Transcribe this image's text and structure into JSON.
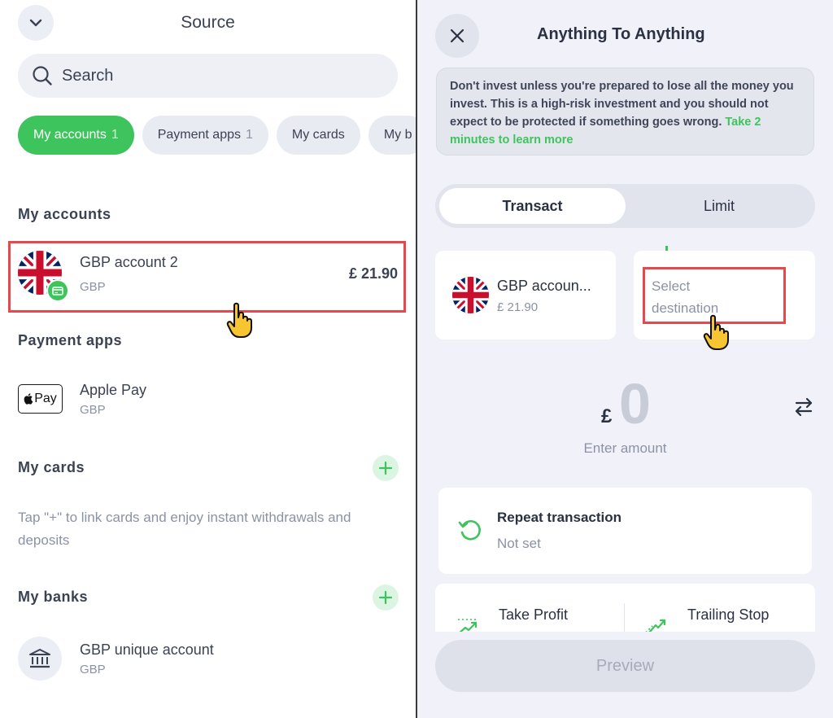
{
  "left": {
    "title": "Source",
    "search": {
      "placeholder": "Search"
    },
    "chips": [
      {
        "label": "My accounts",
        "count": "1"
      },
      {
        "label": "Payment apps",
        "count": "1"
      },
      {
        "label": "My cards"
      },
      {
        "label": "My b"
      }
    ],
    "accounts": {
      "title": "My accounts",
      "items": [
        {
          "name": "GBP account 2",
          "currency": "GBP",
          "balance": "£ 21.90"
        }
      ]
    },
    "payment_apps": {
      "title": "Payment apps",
      "items": [
        {
          "name": "Apple Pay",
          "currency": "GBP",
          "logo_text": "Pay"
        }
      ]
    },
    "cards": {
      "title": "My cards",
      "hint": "Tap \"+\" to link cards and enjoy instant withdrawals and deposits"
    },
    "banks": {
      "title": "My banks",
      "items": [
        {
          "name": "GBP unique account",
          "currency": "GBP"
        }
      ]
    }
  },
  "right": {
    "title": "Anything To Anything",
    "warning": {
      "text": "Don't invest unless you're prepared to lose all the money you invest. This is a high-risk investment and you should not expect to be protected if something goes wrong.",
      "link": "Take 2 minutes to learn more"
    },
    "tabs": [
      {
        "label": "Transact"
      },
      {
        "label": "Limit"
      }
    ],
    "source_card": {
      "name": "GBP accoun...",
      "balance": "£ 21.90"
    },
    "destination": {
      "placeholder_line1": "Select",
      "placeholder_line2": "destination"
    },
    "amount": {
      "currency": "£",
      "value": "0",
      "label": "Enter amount"
    },
    "repeat": {
      "title": "Repeat transaction",
      "value": "Not set"
    },
    "orders": [
      {
        "label": "Take Profit"
      },
      {
        "label": "Trailing Stop"
      }
    ],
    "preview_label": "Preview"
  },
  "colors": {
    "accent": "#3dc45c",
    "highlight": "#e5484d",
    "text": "#3b4253",
    "muted": "#8b92a5"
  }
}
